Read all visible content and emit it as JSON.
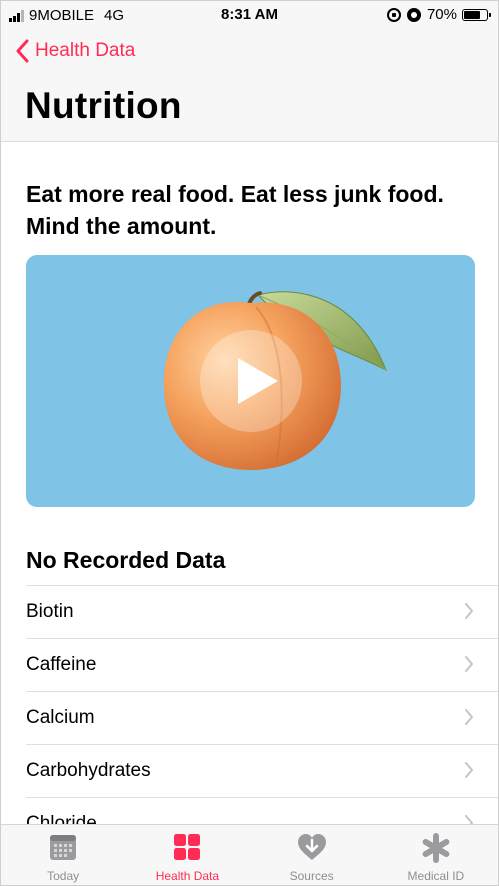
{
  "status_bar": {
    "carrier": "9MOBILE",
    "network": "4G",
    "time": "8:31 AM",
    "battery": "70%"
  },
  "nav": {
    "back_label": "Health Data",
    "title": "Nutrition"
  },
  "content": {
    "tagline": "Eat more real food. Eat less junk food. Mind the amount.",
    "video_bg_color": "#7fc4e6",
    "section_title": "No Recorded Data",
    "items": [
      {
        "label": "Biotin"
      },
      {
        "label": "Caffeine"
      },
      {
        "label": "Calcium"
      },
      {
        "label": "Carbohydrates"
      },
      {
        "label": "Chloride"
      }
    ]
  },
  "tab_bar": {
    "tabs": [
      {
        "label": "Today",
        "icon": "calendar-icon"
      },
      {
        "label": "Health Data",
        "icon": "grid-icon",
        "active": true
      },
      {
        "label": "Sources",
        "icon": "heart-download-icon"
      },
      {
        "label": "Medical ID",
        "icon": "asterisk-icon"
      }
    ]
  },
  "colors": {
    "accent": "#ff2d55",
    "inactive_tab": "#8e8e93"
  }
}
